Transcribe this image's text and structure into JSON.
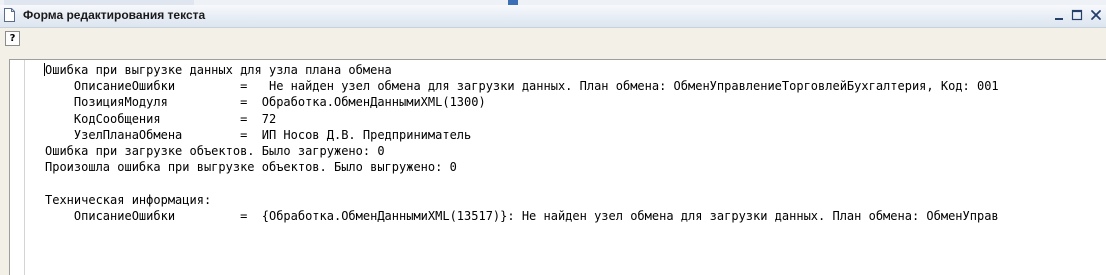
{
  "window": {
    "title": "Форма редактирования текста"
  },
  "toolbar": {
    "help_label": "?"
  },
  "editor": {
    "lines": [
      "Ошибка при выгрузке данных для узла плана обмена",
      "    ОписаниеОшибки         =   Не найден узел обмена для загрузки данных. План обмена: ОбменУправлениеТорговлейБухгалтерия, Код: 001",
      "    ПозицияМодуля          =  Обработка.ОбменДаннымиXML(1300)",
      "    КодСообщения           =  72",
      "    УзелПланаОбмена        =  ИП Носов Д.В. Предприниматель",
      "Ошибка при загрузке объектов. Было загружено: 0",
      "Произошла ошибка при выгрузке объектов. Было выгружено: 0",
      "",
      "Техническая информация:",
      "    ОписаниеОшибки         =  {Обработка.ОбменДаннымиXML(13517)}: Не найден узел обмена для загрузки данных. План обмена: ОбменУправ"
    ]
  },
  "icons": {
    "title": "document-icon",
    "minimize": "minimize-icon",
    "maximize": "maximize-icon",
    "close": "close-icon"
  },
  "colors": {
    "title_bar": "#e7edf5",
    "window_bg": "#f3f1e7",
    "editor_bg": "#ffffff",
    "control_glyph": "#253f6b"
  }
}
